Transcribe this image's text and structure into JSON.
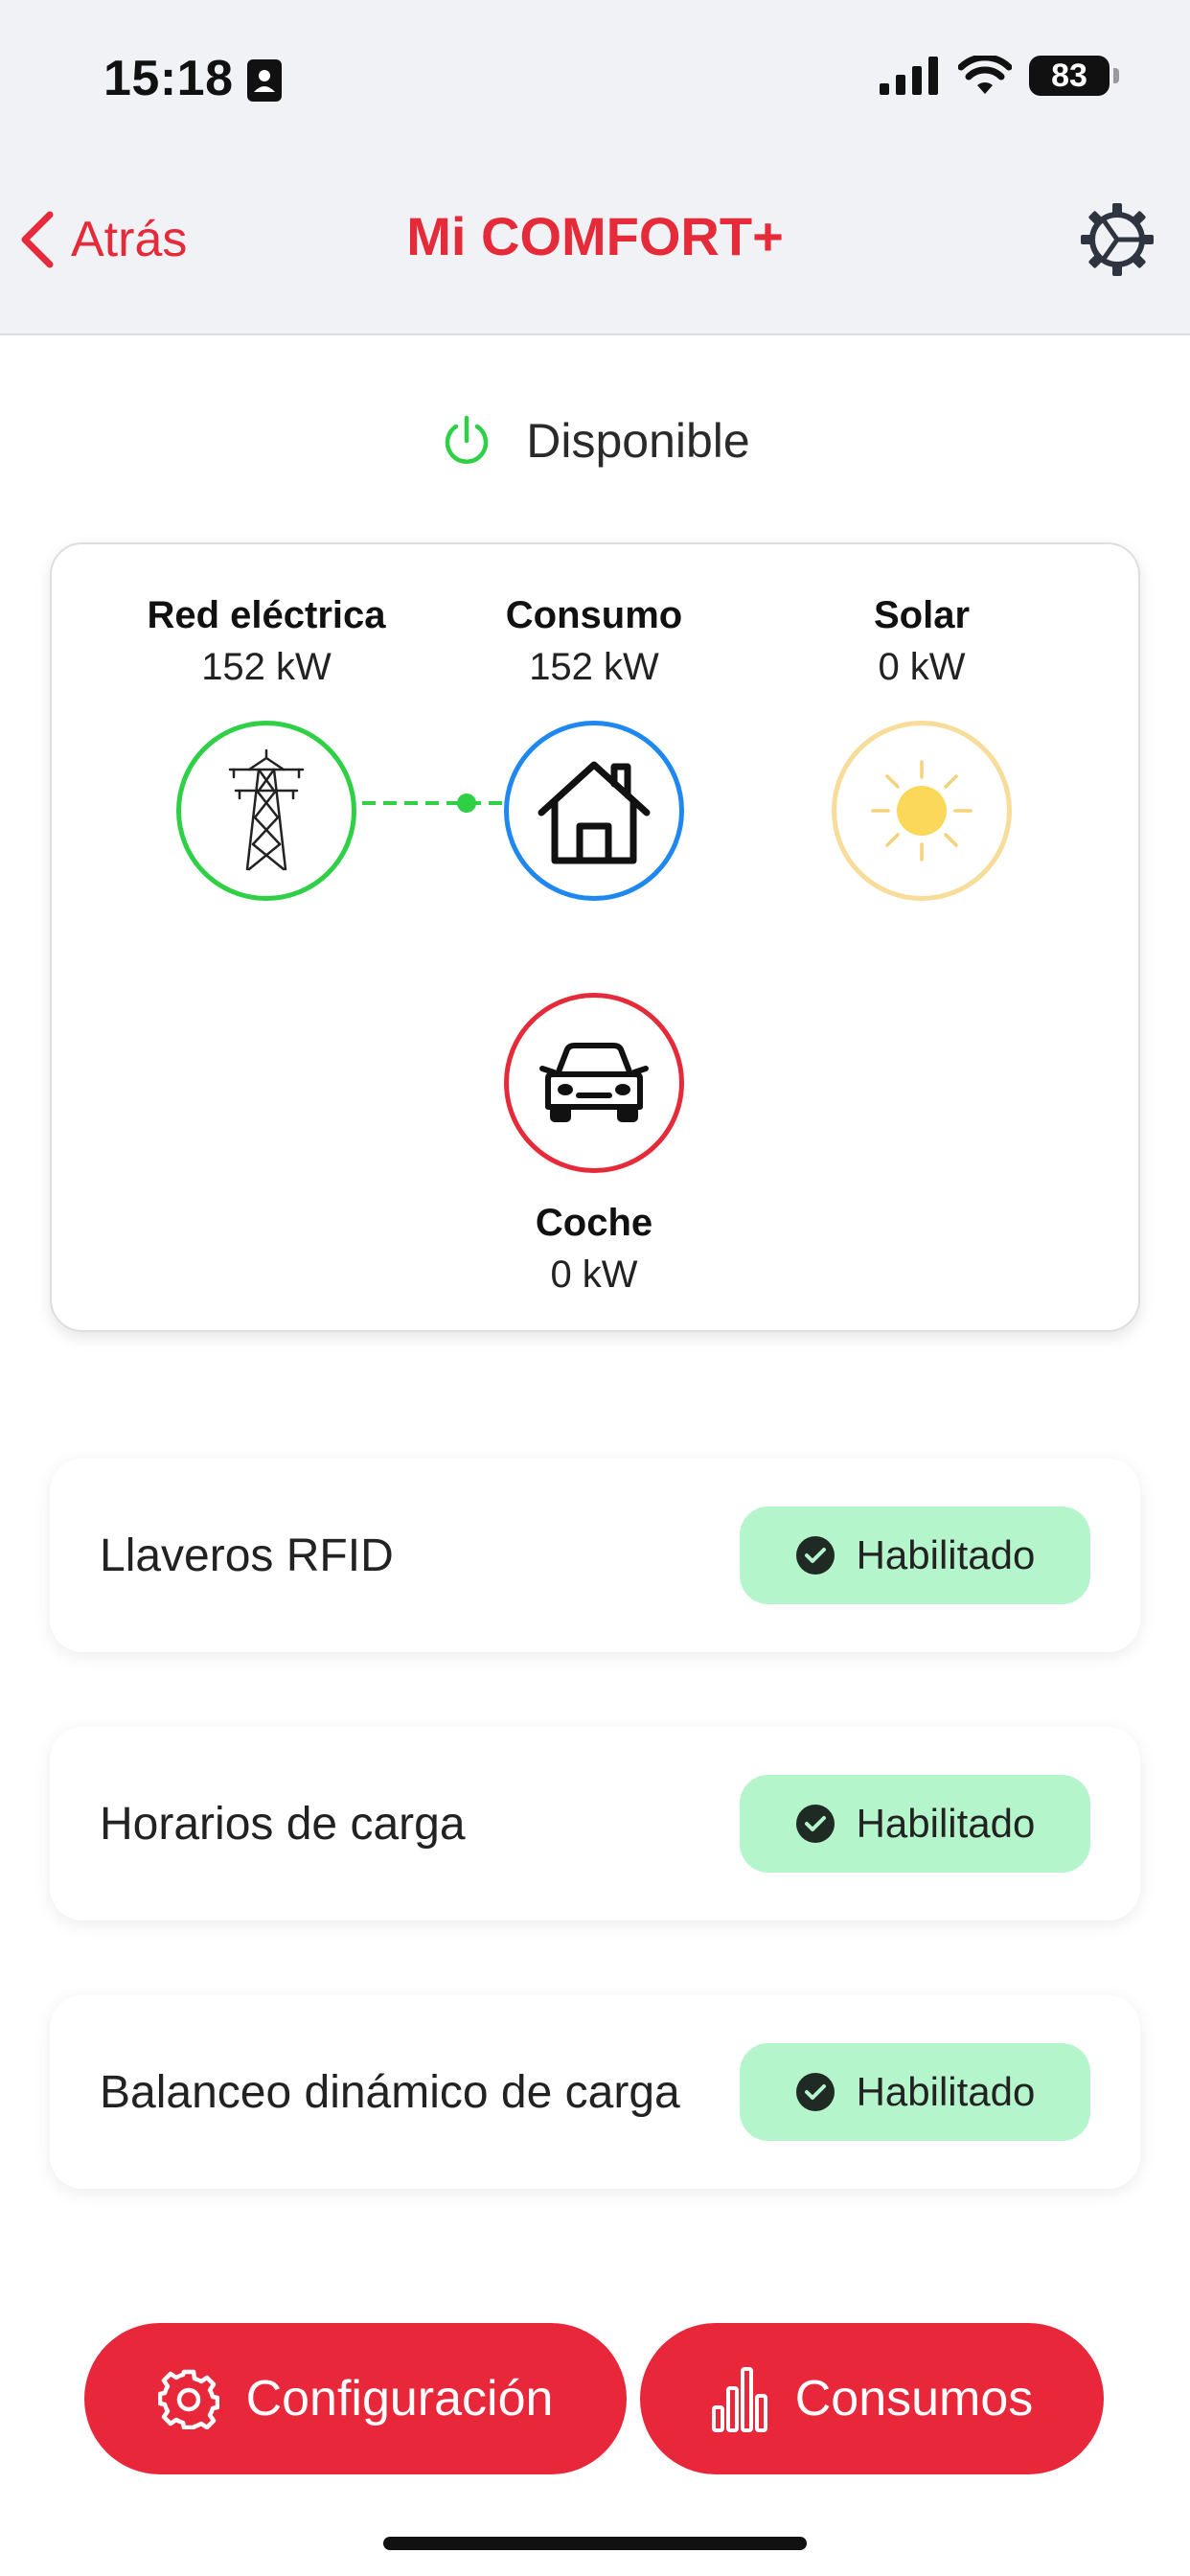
{
  "status_bar": {
    "time": "15:18",
    "battery": "83"
  },
  "nav": {
    "back_label": "Atrás",
    "title": "Mi COMFORT+"
  },
  "status": {
    "label": "Disponible"
  },
  "energy": {
    "grid": {
      "title": "Red eléctrica",
      "value": "152 kW"
    },
    "consumption": {
      "title": "Consumo",
      "value": "152 kW"
    },
    "solar": {
      "title": "Solar",
      "value": "0 kW"
    },
    "car": {
      "title": "Coche",
      "value": "0 kW"
    }
  },
  "features": [
    {
      "label": "Llaveros RFID",
      "badge": "Habilitado"
    },
    {
      "label": "Horarios de carga",
      "badge": "Habilitado"
    },
    {
      "label": "Balanceo dinámico de carga",
      "badge": "Habilitado"
    }
  ],
  "buttons": {
    "config_label": "Configuración",
    "consumption_label": "Consumos"
  },
  "colors": {
    "accent": "#e8283a",
    "grid": "#2fcf46",
    "consumption": "#1e88f0",
    "solar": "#f7dc9a",
    "car": "#e52a3a",
    "badge_bg": "#b5f5cb"
  },
  "icons": {
    "back": "chevron-left-icon",
    "settings": "settings-gear-icon",
    "status": "power-icon",
    "grid": "power-tower-icon",
    "consumption": "house-icon",
    "solar": "sun-icon",
    "car": "car-icon",
    "badge": "check-circle-icon",
    "config": "gear-icon",
    "consumption_chart": "bar-chart-icon"
  }
}
